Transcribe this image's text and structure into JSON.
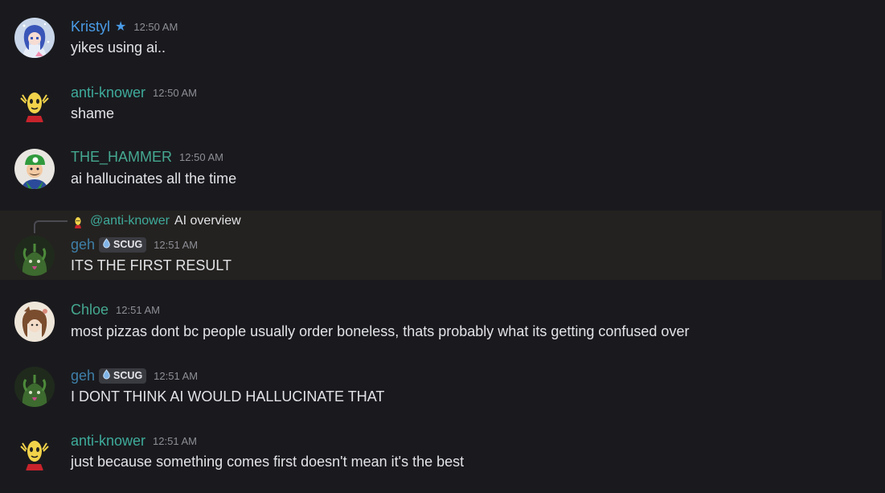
{
  "colors": {
    "background": "#1a1a1e",
    "highlight_background": "#242220",
    "name_blue": "#4a9ce8",
    "name_teal": "#3eab9b",
    "name_green_teal": "#45a891",
    "name_geh": "#3e7fa8",
    "timestamp": "#8d8e96",
    "text": "#e2e3e6"
  },
  "messages": [
    {
      "author": "Kristyl",
      "badge_icon": "star-icon",
      "timestamp": "12:50 AM",
      "text": "yikes using ai..",
      "avatar": "anime-girl-avatar"
    },
    {
      "author": "anti-knower",
      "timestamp": "12:50 AM",
      "text": "shame",
      "avatar": "yellow-creature-avatar"
    },
    {
      "author": "THE_HAMMER",
      "timestamp": "12:50 AM",
      "text": "ai hallucinates all the time",
      "avatar": "luigi-avatar"
    },
    {
      "author": "geh",
      "tag": "SCUG",
      "timestamp": "12:51 AM",
      "text": "ITS THE FIRST RESULT",
      "avatar": "green-slug-avatar",
      "reply": {
        "mention": "@anti-knower",
        "text": "AI overview"
      }
    },
    {
      "author": "Chloe",
      "timestamp": "12:51 AM",
      "text": "most pizzas dont bc people usually order boneless, thats probably what its getting confused over",
      "avatar": "sketch-avatar"
    },
    {
      "author": "geh",
      "tag": "SCUG",
      "timestamp": "12:51 AM",
      "text": "I DONT THINK AI WOULD HALLUCINATE THAT",
      "avatar": "green-slug-avatar"
    },
    {
      "author": "anti-knower",
      "timestamp": "12:51 AM",
      "text": "just because something comes first doesn't mean it's the best",
      "avatar": "yellow-creature-avatar"
    }
  ]
}
